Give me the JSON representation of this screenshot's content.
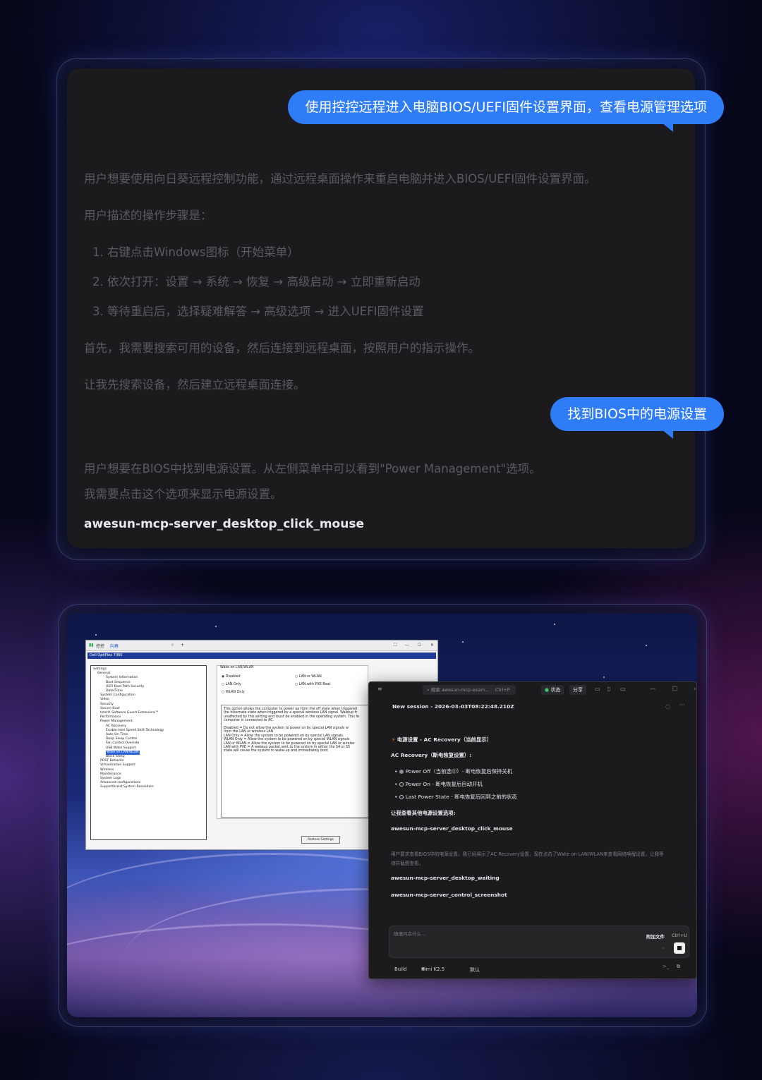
{
  "card1": {
    "bubble_top": "使用控控远程进入电脑BIOS/UEFI固件设置界面，查看电源管理选项",
    "para1": "用户想要使用向日葵远程控制功能，通过远程桌面操作来重启电脑并进入BIOS/UEFI固件设置界面。",
    "para2": "用户描述的操作步骤是：",
    "steps": [
      "1. 右键点击Windows图标（开始菜单）",
      "2. 依次打开：设置 → 系统 → 恢复 → 高级启动 → 立即重新启动",
      "3. 等待重启后，选择疑难解答 → 高级选项 → 进入UEFI固件设置"
    ],
    "para3": "首先，我需要搜索可用的设备，然后连接到远程桌面，按照用户的指示操作。",
    "para4": "让我先搜索设备，然后建立远程桌面连接。",
    "bubble_bottom": "找到BIOS中的电源设置",
    "para5": "用户想要在BIOS中找到电源设置。从左侧菜单中可以看到\"Power Management\"选项。",
    "para6": "我需要点击这个选项来显示电源设置。",
    "tool_call": "awesun-mcp-server_desktop_click_mouse"
  },
  "remote": {
    "tab_app": "控控",
    "tab_sub": "向春",
    "bios_title": "Dell OptiPlex 7080",
    "tree": [
      "Settings",
      "General",
      "System Information",
      "Boot Sequence",
      "UEFI Boot Path Security",
      "Date/Time",
      "System Configuration",
      "Video",
      "Security",
      "Secure Boot",
      "Intel® Software Guard Extensions™",
      "Performance",
      "Power Management",
      "AC Recovery",
      "Enable Intel Speed Shift Technology",
      "Auto On Time",
      "Deep Sleep Control",
      "Fan Control Override",
      "USB Wake Support",
      "Wake on LAN/WLAN",
      "Block Sleep",
      "POST Behavior",
      "Virtualization Support",
      "Wireless",
      "Maintenance",
      "System Logs",
      "Advanced configurations",
      "SupportAssist System Resolution"
    ],
    "panel_heading": "Wake on LAN/WLAN",
    "options": [
      "Disabled",
      "LAN Only",
      "WLAN Only",
      "LAN or WLAN",
      "LAN with PXE Boot"
    ],
    "desc": [
      "This option allows the computer to power up from the off state when triggered",
      "the hibernate state when triggered by a special wireless LAN signal. Wakeup fr",
      "unaffected by this setting and must be enabled in the operating system. This fe",
      "computer is connected to AC.",
      "",
      "Disabled      = Do not allow the system to power on by special LAN signals w",
      "                   from the LAN or wireless LAN",
      "LAN Only     = Allow the system to be powered on by special LAN signals.",
      "WLAN Only   = Allow the system to be powered on by special WLAN signals",
      "LAN or WLAN = Allow the system to be powered on by special LAN or wireles",
      "LAN with PXE = A wakeup packet sent to the system in either the S4 or S5",
      "                   state will cause the system to wake-up and immediately boot"
    ],
    "restore": "Restore Settings"
  },
  "chat": {
    "search_placeholder": "搜索 awesun-mcp-exam...",
    "search_shortcut": "Ctrl+P",
    "status": "状态",
    "share": "分享",
    "session": "New session - 2026-03-03T08:22:48.210Z",
    "heading": "电源设置 - AC Recovery（当前显示）",
    "subheading": "AC Recovery（断电恢复设置）:",
    "items": [
      "Power Off（当前选中）- 断电恢复后保持关机",
      "Power On - 断电恢复后自动开机",
      "Last Power State - 断电恢复后回到之前的状态"
    ],
    "next": "让我查看其他电源设置选项:",
    "tool1": "awesun-mcp-server_desktop_click_mouse",
    "note1": "用户要求查看BIOS中的电源设置。我已经展示了AC Recovery设置，现在点击了Wake on LAN/WLAN来查看网络唤醒设置。让我等",
    "note2": "待并截图查看。",
    "tool2": "awesun-mcp-server_desktop_waiting",
    "tool3": "awesun-mcp-server_control_screenshot",
    "input_placeholder": "随便问点什么...",
    "attach": "附加文件",
    "attach_shortcut": "Ctrl+U",
    "mode": "Build",
    "model": "Kimi K2.5",
    "variant": "默认"
  }
}
